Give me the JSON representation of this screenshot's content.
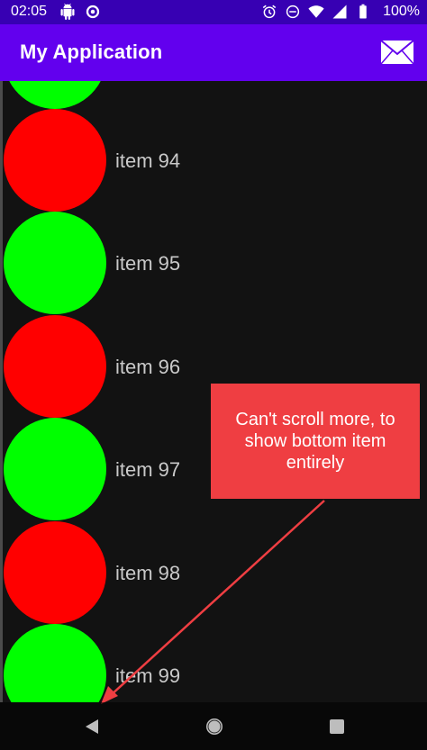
{
  "status_bar": {
    "time": "02:05",
    "battery_percent": "100%",
    "left_icons": [
      "android-icon",
      "sync-icon"
    ],
    "right_icons": [
      "alarm-icon",
      "do-not-disturb-icon",
      "wifi-icon",
      "signal-icon",
      "battery-icon"
    ]
  },
  "app_bar": {
    "title": "My Application",
    "action_icon": "mail-icon",
    "color": "#6200EE",
    "status_color": "#3700B3"
  },
  "list": {
    "items": [
      {
        "label": "",
        "color": "#00FF00"
      },
      {
        "label": "item 94",
        "color": "#FF0000"
      },
      {
        "label": "item 95",
        "color": "#00FF00"
      },
      {
        "label": "item 96",
        "color": "#FF0000"
      },
      {
        "label": "item 97",
        "color": "#00FF00"
      },
      {
        "label": "item 98",
        "color": "#FF0000"
      },
      {
        "label": "item 99",
        "color": "#00FF00"
      }
    ]
  },
  "annotation": {
    "text": "Can't scroll more, to show bottom item entirely",
    "color": "#EF3E42"
  },
  "nav_bar": {
    "buttons": [
      "back-icon",
      "home-icon",
      "recents-icon"
    ]
  }
}
